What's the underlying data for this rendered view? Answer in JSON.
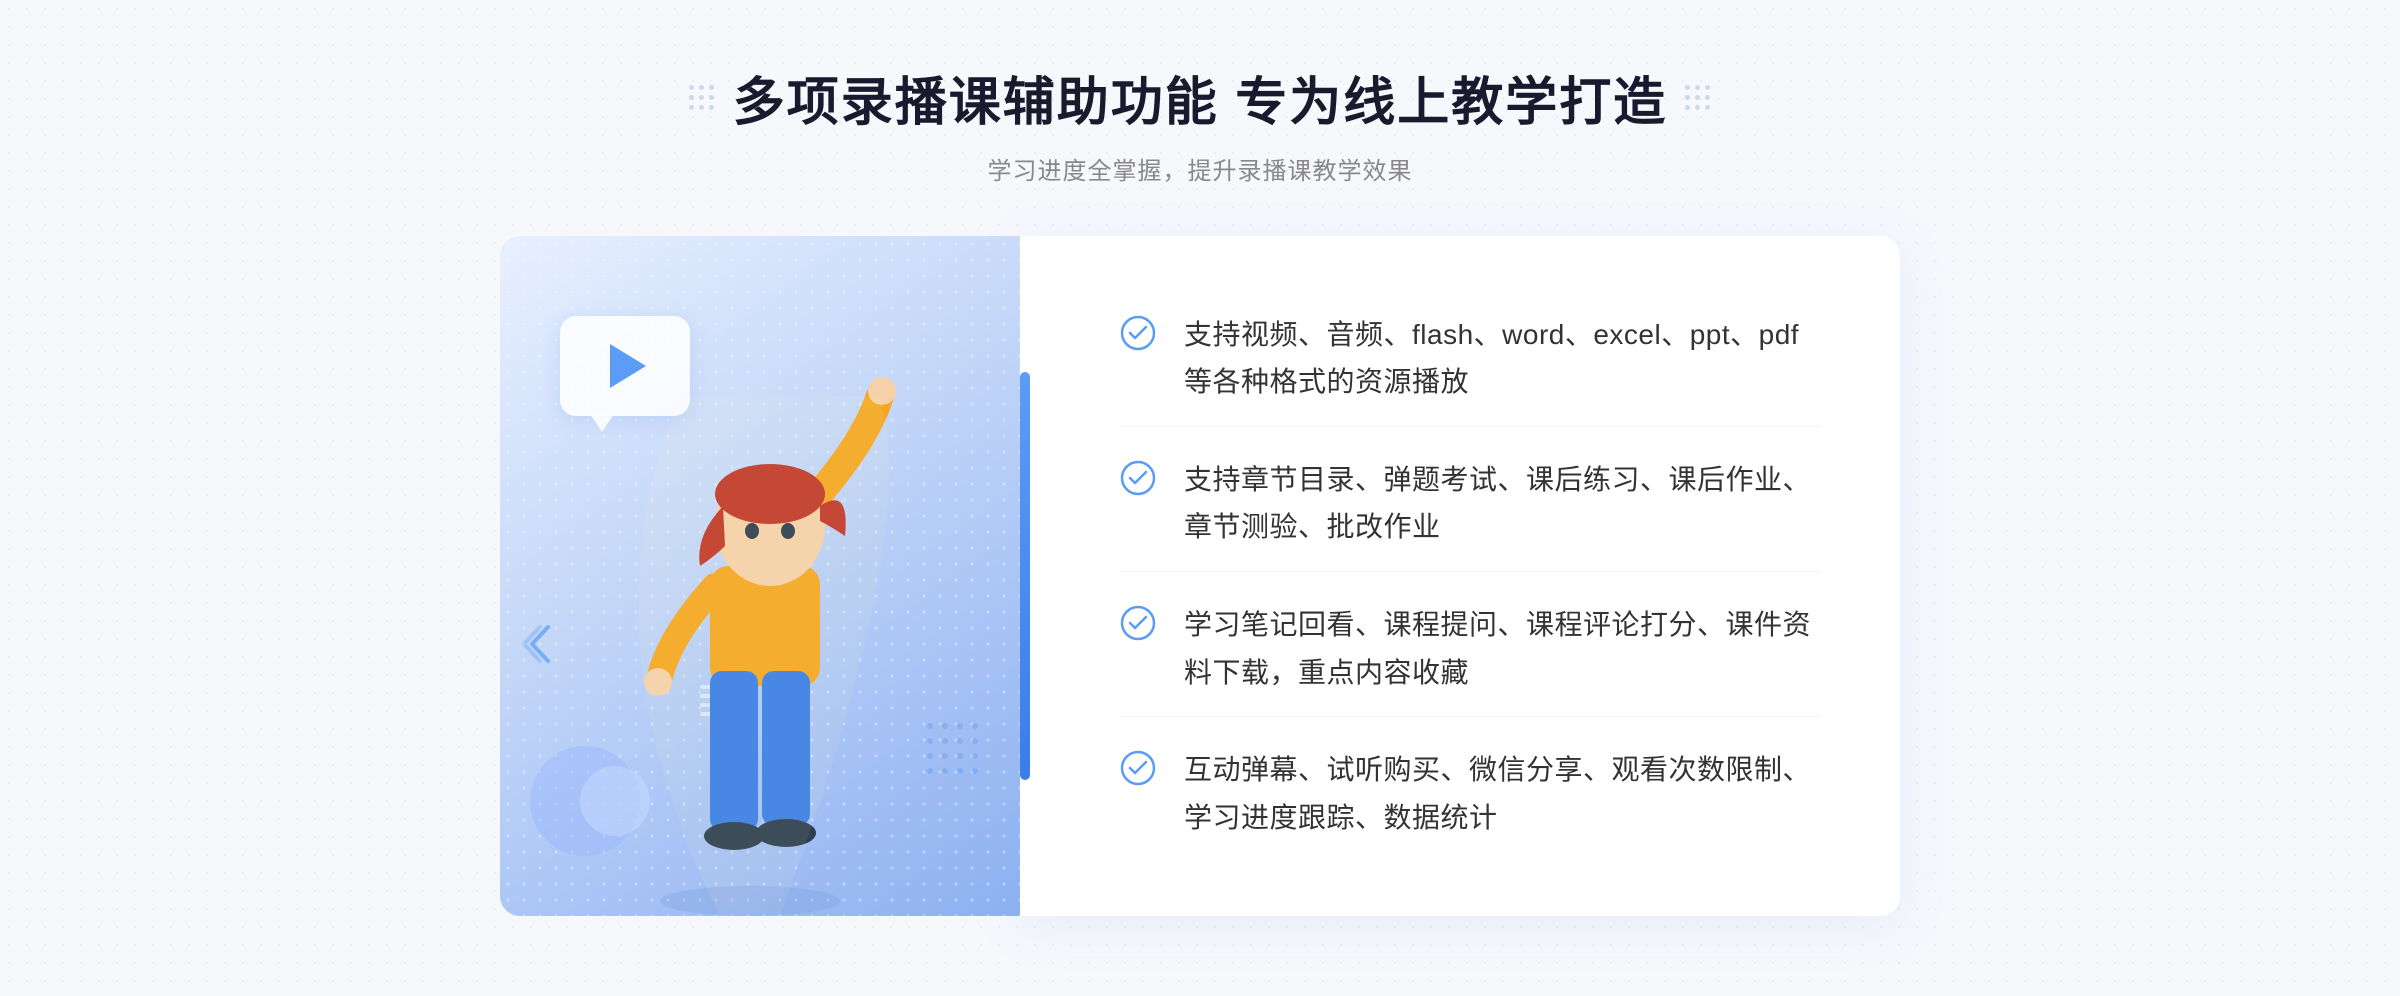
{
  "header": {
    "title": "多项录播课辅助功能 专为线上教学打造",
    "subtitle": "学习进度全掌握，提升录播课教学效果"
  },
  "features": [
    {
      "id": 1,
      "text": "支持视频、音频、flash、word、excel、ppt、pdf等各种格式的资源播放"
    },
    {
      "id": 2,
      "text": "支持章节目录、弹题考试、课后练习、课后作业、章节测验、批改作业"
    },
    {
      "id": 3,
      "text": "学习笔记回看、课程提问、课程评论打分、课件资料下载，重点内容收藏"
    },
    {
      "id": 4,
      "text": "互动弹幕、试听购买、微信分享、观看次数限制、学习进度跟踪、数据统计"
    }
  ],
  "icons": {
    "check": "check-circle-icon",
    "play": "play-icon",
    "chevron": "chevron-icon"
  }
}
